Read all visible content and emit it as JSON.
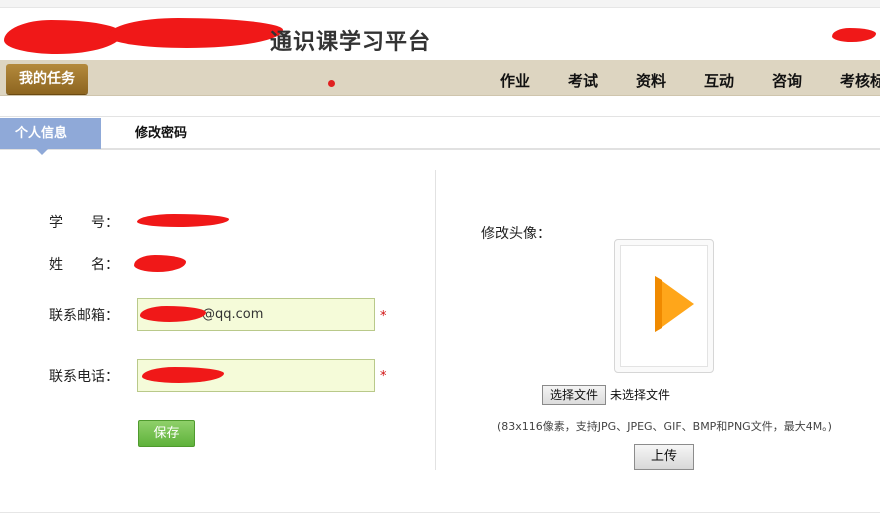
{
  "header": {
    "site_title": "通识课学习平台"
  },
  "nav": {
    "my_tasks_label": "我的任务",
    "items": [
      "作业",
      "考试",
      "资料",
      "互动",
      "咨询",
      "考核标"
    ]
  },
  "tabs": {
    "active_label": "个人信息",
    "other_label": "修改密码"
  },
  "form": {
    "student_id_label": "学　　号：",
    "name_label": "姓　　名：",
    "email_label": "联系邮箱：",
    "email_value": "@qq.com",
    "phone_label": "联系电话：",
    "required_mark": "*",
    "save_label": "保存"
  },
  "avatar": {
    "label": "修改头像：",
    "choose_file_label": "选择文件",
    "no_file_label": "未选择文件",
    "hint": "(83x116像素，支持JPG、JPEG、GIF、BMP和PNG文件，最大4M。)",
    "upload_label": "上传",
    "placeholder_icon": "play-icon"
  },
  "colors": {
    "nav_bg": "#ddd5c1",
    "task_button": "#9a7028",
    "active_tab": "#8fa9d8",
    "input_bg": "#f5fbd9",
    "save_button": "#6cbd45",
    "avatar_play": "#ffa61a",
    "redaction": "#f01818"
  }
}
